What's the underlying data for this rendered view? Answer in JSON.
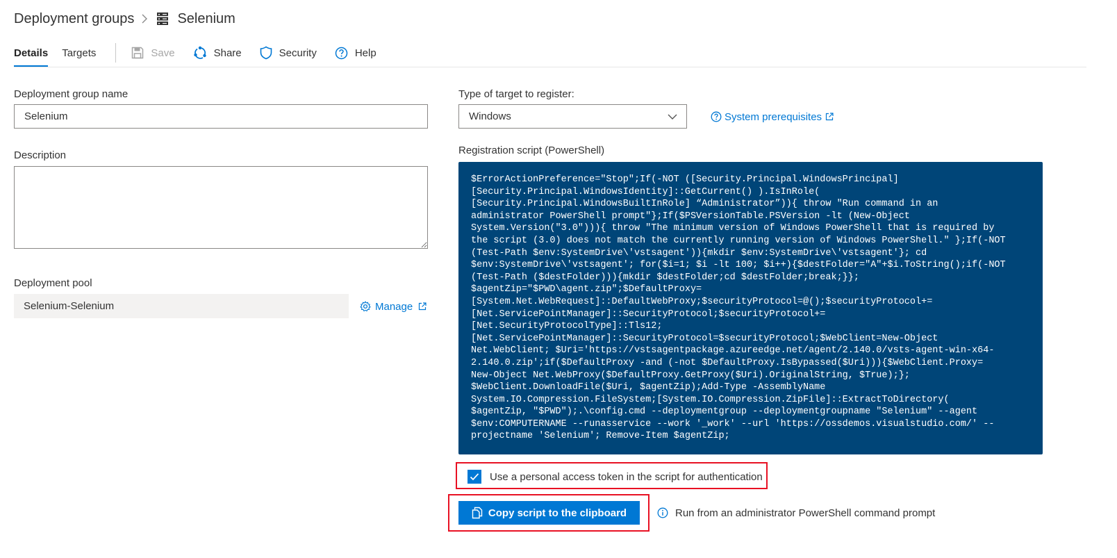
{
  "breadcrumb": {
    "parent": "Deployment groups",
    "current": "Selenium"
  },
  "tabs": [
    {
      "label": "Details",
      "active": true
    },
    {
      "label": "Targets",
      "active": false
    }
  ],
  "toolbar": {
    "save_label": "Save",
    "share_label": "Share",
    "security_label": "Security",
    "help_label": "Help"
  },
  "form": {
    "name_label": "Deployment group name",
    "name_value": "Selenium",
    "description_label": "Description",
    "description_value": "",
    "pool_label": "Deployment pool",
    "pool_value": "Selenium-Selenium",
    "manage_label": "Manage"
  },
  "target": {
    "type_label": "Type of target to register:",
    "type_value": "Windows",
    "prereq_label": "System prerequisites",
    "script_label": "Registration script (PowerShell)",
    "script": "$ErrorActionPreference=\"Stop\";If(-NOT ([Security.Principal.WindowsPrincipal]\n[Security.Principal.WindowsIdentity]::GetCurrent() ).IsInRole(\n[Security.Principal.WindowsBuiltInRole] “Administrator”)){ throw \"Run command in an\nadministrator PowerShell prompt\"};If($PSVersionTable.PSVersion -lt (New-Object\nSystem.Version(\"3.0\"))){ throw \"The minimum version of Windows PowerShell that is required by\nthe script (3.0) does not match the currently running version of Windows PowerShell.\" };If(-NOT\n(Test-Path $env:SystemDrive\\'vstsagent')){mkdir $env:SystemDrive\\'vstsagent'}; cd\n$env:SystemDrive\\'vstsagent'; for($i=1; $i -lt 100; $i++){$destFolder=\"A\"+$i.ToString();if(-NOT\n(Test-Path ($destFolder))){mkdir $destFolder;cd $destFolder;break;}};\n$agentZip=\"$PWD\\agent.zip\";$DefaultProxy=\n[System.Net.WebRequest]::DefaultWebProxy;$securityProtocol=@();$securityProtocol+=\n[Net.ServicePointManager]::SecurityProtocol;$securityProtocol+=\n[Net.SecurityProtocolType]::Tls12;\n[Net.ServicePointManager]::SecurityProtocol=$securityProtocol;$WebClient=New-Object\nNet.WebClient; $Uri='https://vstsagentpackage.azureedge.net/agent/2.140.0/vsts-agent-win-x64-\n2.140.0.zip';if($DefaultProxy -and (-not $DefaultProxy.IsBypassed($Uri))){$WebClient.Proxy=\nNew-Object Net.WebProxy($DefaultProxy.GetProxy($Uri).OriginalString, $True);};\n$WebClient.DownloadFile($Uri, $agentZip);Add-Type -AssemblyName\nSystem.IO.Compression.FileSystem;[System.IO.Compression.ZipFile]::ExtractToDirectory(\n$agentZip, \"$PWD\");.\\config.cmd --deploymentgroup --deploymentgroupname \"Selenium\" --agent\n$env:COMPUTERNAME --runasservice --work '_work' --url 'https://ossdemos.visualstudio.com/' --\nprojectname 'Selenium'; Remove-Item $agentZip;",
    "pat_label": "Use a personal access token in the script for authentication",
    "pat_checked": true,
    "copy_label": "Copy script to the clipboard",
    "hint": "Run from an administrator PowerShell command prompt"
  },
  "colors": {
    "accent": "#0078d4",
    "script_bg": "#004578",
    "highlight": "#e81123"
  }
}
